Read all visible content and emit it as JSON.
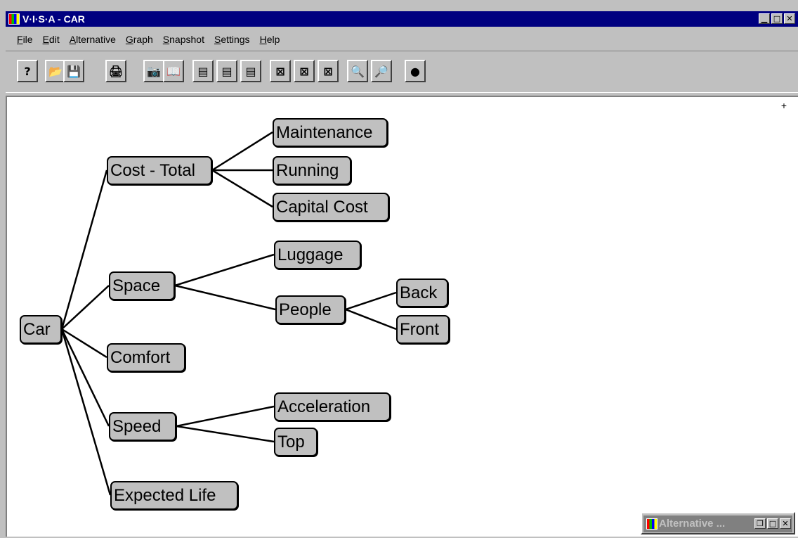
{
  "window": {
    "title": "V·I·S·A - CAR",
    "controls": [
      "▁",
      "□",
      "✕"
    ]
  },
  "menu": [
    "File",
    "Edit",
    "Alternative",
    "Graph",
    "Snapshot",
    "Settings",
    "Help"
  ],
  "toolbar": [
    {
      "name": "help-icon",
      "glyph": "?"
    },
    {
      "name": "open-folder-icon",
      "glyph": "📂"
    },
    {
      "name": "save-disk-icon",
      "glyph": "💾"
    },
    {
      "name": "print-icon",
      "glyph": "🖨"
    },
    {
      "name": "camera-icon",
      "glyph": "📷"
    },
    {
      "name": "book-icon",
      "glyph": "📖"
    },
    {
      "name": "chart-icon-1",
      "glyph": "▤"
    },
    {
      "name": "chart-icon-2",
      "glyph": "▤"
    },
    {
      "name": "chart-icon-3",
      "glyph": "▤"
    },
    {
      "name": "graph-icon-1",
      "glyph": "⊠"
    },
    {
      "name": "graph-icon-2",
      "glyph": "⊠"
    },
    {
      "name": "graph-icon-3",
      "glyph": "⊠"
    },
    {
      "name": "zoom-in-icon",
      "glyph": "🔍"
    },
    {
      "name": "zoom-out-icon",
      "glyph": "🔎"
    },
    {
      "name": "bomb-icon",
      "glyph": "●"
    }
  ],
  "canvas_marker": "+",
  "nodes": [
    {
      "id": "car",
      "label": "Car"
    },
    {
      "id": "cost",
      "label": "Cost - Total"
    },
    {
      "id": "space",
      "label": "Space"
    },
    {
      "id": "comfort",
      "label": "Comfort"
    },
    {
      "id": "speed",
      "label": "Speed"
    },
    {
      "id": "life",
      "label": "Expected Life"
    },
    {
      "id": "maint",
      "label": "Maintenance"
    },
    {
      "id": "running",
      "label": "Running"
    },
    {
      "id": "capital",
      "label": "Capital Cost"
    },
    {
      "id": "luggage",
      "label": "Luggage"
    },
    {
      "id": "people",
      "label": "People"
    },
    {
      "id": "back",
      "label": "Back"
    },
    {
      "id": "front",
      "label": "Front"
    },
    {
      "id": "accel",
      "label": "Acceleration"
    },
    {
      "id": "top",
      "label": "Top"
    }
  ],
  "edges": [
    [
      "car",
      "cost"
    ],
    [
      "car",
      "space"
    ],
    [
      "car",
      "comfort"
    ],
    [
      "car",
      "speed"
    ],
    [
      "car",
      "life"
    ],
    [
      "cost",
      "maint"
    ],
    [
      "cost",
      "running"
    ],
    [
      "cost",
      "capital"
    ],
    [
      "space",
      "luggage"
    ],
    [
      "space",
      "people"
    ],
    [
      "people",
      "back"
    ],
    [
      "people",
      "front"
    ],
    [
      "speed",
      "accel"
    ],
    [
      "speed",
      "top"
    ]
  ],
  "minimized_window": {
    "title": "Alternative ...",
    "controls": [
      "❐",
      "□",
      "✕"
    ]
  }
}
